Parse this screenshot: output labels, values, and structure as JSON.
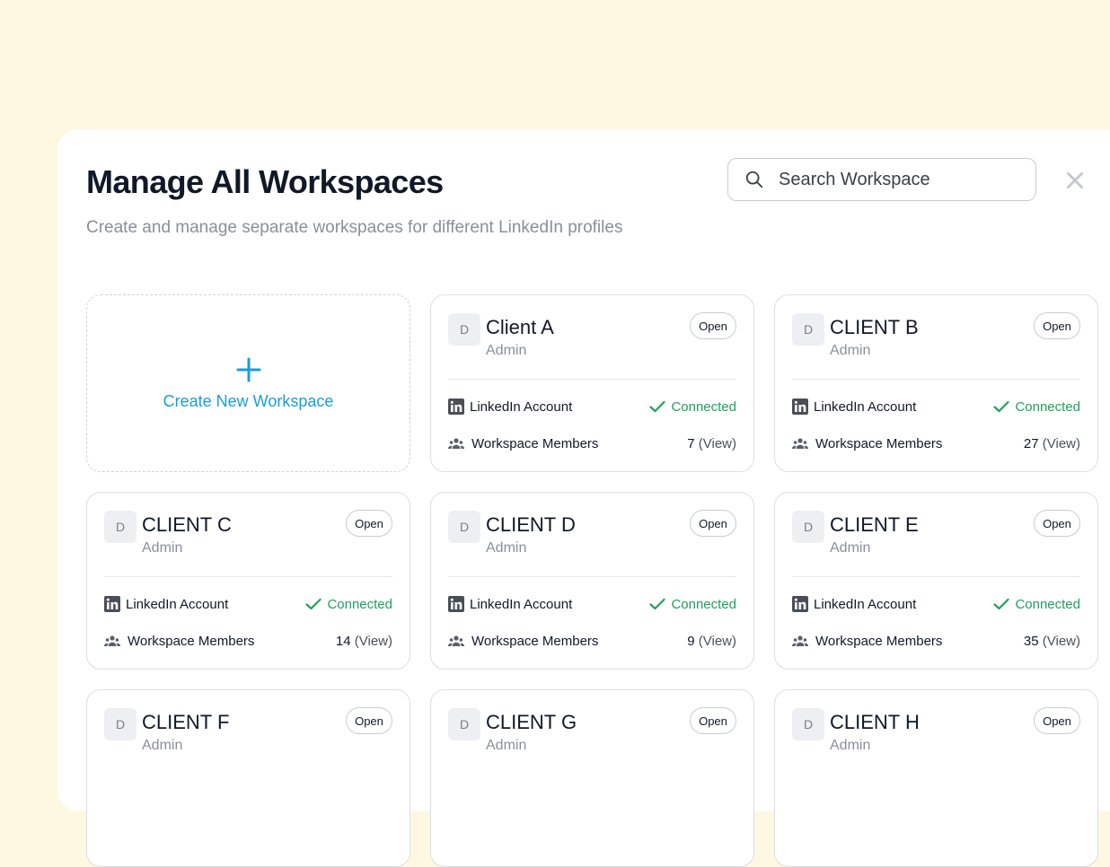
{
  "header": {
    "title": "Manage All Workspaces",
    "subtitle": "Create and manage separate workspaces for different LinkedIn profiles"
  },
  "search": {
    "placeholder": "Search Workspace"
  },
  "create_card": {
    "label": "Create New Workspace"
  },
  "labels": {
    "linkedin": "LinkedIn Account",
    "members": "Workspace Members",
    "open": "Open"
  },
  "colors": {
    "accent": "#1A9DD9",
    "connected": "#21A05A",
    "background": "#FEF7E1"
  },
  "workspaces": [
    {
      "initial": "D",
      "name": "Client A",
      "role": "Admin",
      "status": "Connected",
      "members": "7",
      "view": "(View)"
    },
    {
      "initial": "D",
      "name": "CLIENT B",
      "role": "Admin",
      "status": "Connected",
      "members": "27",
      "view": "(View)"
    },
    {
      "initial": "D",
      "name": "CLIENT C",
      "role": "Admin",
      "status": "Connected",
      "members": "14",
      "view": "(View)"
    },
    {
      "initial": "D",
      "name": "CLIENT D",
      "role": "Admin",
      "status": "Connected",
      "members": "9",
      "view": "(View)"
    },
    {
      "initial": "D",
      "name": "CLIENT E",
      "role": "Admin",
      "status": "Connected",
      "members": "35",
      "view": "(View)"
    },
    {
      "initial": "D",
      "name": "CLIENT F",
      "role": "Admin"
    },
    {
      "initial": "D",
      "name": "CLIENT G",
      "role": "Admin"
    },
    {
      "initial": "D",
      "name": "CLIENT H",
      "role": "Admin"
    }
  ]
}
